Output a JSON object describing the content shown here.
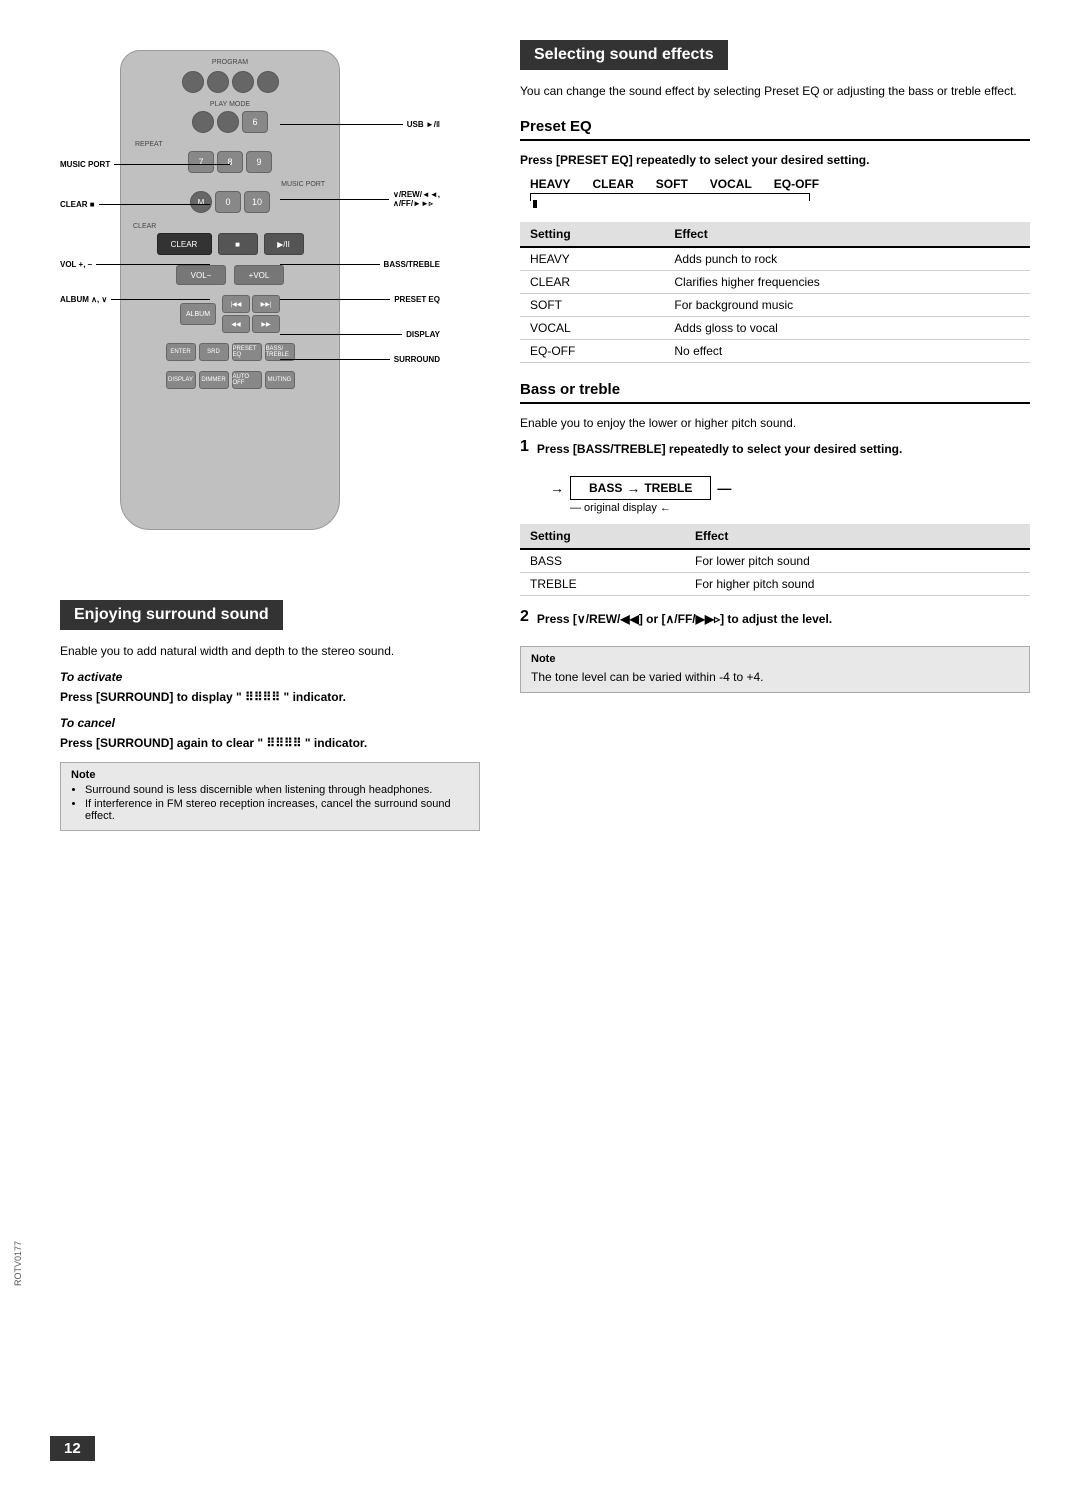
{
  "page": {
    "number": "12",
    "rotv": "ROTV0177"
  },
  "left_section": {
    "header": "Enjoying surround sound",
    "intro": "Enable you to add natural width and depth to the stereo sound.",
    "to_activate_label": "To activate",
    "to_activate_text": "Press [SURROUND] to display “⦙⦙⦙⦙” indicator.",
    "to_cancel_label": "To cancel",
    "to_cancel_text": "Press [SURROUND] again to clear “⦙⦙⦙⦙” indicator.",
    "note_title": "Note",
    "notes": [
      "Surround sound is less discernible when listening through headphones.",
      "If interference in FM stereo reception increases, cancel the surround sound effect."
    ]
  },
  "right_section": {
    "header": "Selecting sound effects",
    "intro": "You can change the sound effect by selecting Preset EQ or adjusting the bass or treble effect.",
    "preset_eq": {
      "title": "Preset EQ",
      "instruction": "Press [PRESET EQ] repeatedly to select your desired setting.",
      "eq_options": [
        "HEAVY",
        "CLEAR",
        "SOFT",
        "VOCAL",
        "EQ-OFF"
      ],
      "table_headers": [
        "Setting",
        "Effect"
      ],
      "table_rows": [
        [
          "HEAVY",
          "Adds punch to rock"
        ],
        [
          "CLEAR",
          "Clarifies higher frequencies"
        ],
        [
          "SOFT",
          "For background music"
        ],
        [
          "VOCAL",
          "Adds gloss to vocal"
        ],
        [
          "EQ-OFF",
          "No effect"
        ]
      ]
    },
    "bass_treble": {
      "title": "Bass or treble",
      "intro": "Enable you to enjoy the lower or higher pitch sound.",
      "step1_label": "1",
      "step1_text": "Press [BASS/TREBLE] repeatedly to select your desired setting.",
      "diagram_arrow1": "→",
      "diagram_bass": "BASS",
      "diagram_arrow2": "→",
      "diagram_treble": "TREBLE",
      "diagram_orig": "original display",
      "table_headers": [
        "Setting",
        "Effect"
      ],
      "table_rows": [
        [
          "BASS",
          "For lower pitch sound"
        ],
        [
          "TREBLE",
          "For higher pitch sound"
        ]
      ],
      "step2_label": "2",
      "step2_text": "Press [∨/REW/◄◄] or [∧/FF/►►▹] to adjust the level.",
      "note_title": "Note",
      "note_text": "The tone level can be varied within -4 to +4."
    }
  },
  "remote_labels": {
    "left": {
      "music_port": "MUSIC PORT",
      "clear": "CLEAR ■",
      "vol": "VOL +, –",
      "album": "ALBUM ∧, ∨"
    },
    "right": {
      "usb": "USB ►/‖",
      "vrew": "∨/REW/◄◄,",
      "vff": "∧/FF/►►▹",
      "bass_treble": "BASS/TREBLE",
      "preset_eq": "PRESET EQ",
      "display": "DISPLAY",
      "surround": "SURROUND"
    }
  }
}
